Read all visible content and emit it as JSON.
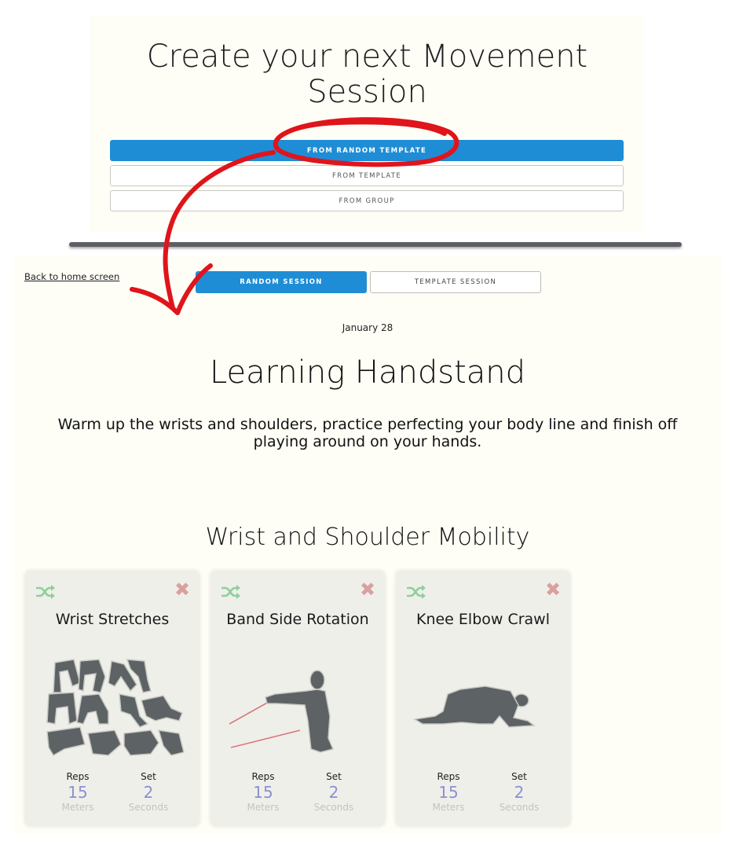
{
  "builder": {
    "title": "Create your next Movement Session",
    "options": [
      {
        "label": "FROM RANDOM TEMPLATE"
      },
      {
        "label": "FROM TEMPLATE"
      },
      {
        "label": "FROM GROUP"
      }
    ]
  },
  "session": {
    "back_link": "Back to home screen",
    "tabs": [
      {
        "label": "RANDOM SESSION",
        "active": true
      },
      {
        "label": "TEMPLATE SESSION",
        "active": false
      }
    ],
    "date": "January 28",
    "title": "Learning Handstand",
    "description": "Warm up the wrists and shoulders, practice perfecting your body line and finish off playing around on your hands.",
    "section": {
      "title": "Wrist and Shoulder Mobility",
      "exercises": [
        {
          "name": "Wrist Stretches",
          "reps_label": "Reps",
          "reps": "15",
          "reps_unit": "Meters",
          "set_label": "Set",
          "set": "2",
          "set_unit": "Seconds",
          "shuffle_icon": "shuffle-icon",
          "remove_icon": "close-icon"
        },
        {
          "name": "Band Side Rotation",
          "reps_label": "Reps",
          "reps": "15",
          "reps_unit": "Meters",
          "set_label": "Set",
          "set": "2",
          "set_unit": "Seconds",
          "shuffle_icon": "shuffle-icon",
          "remove_icon": "close-icon"
        },
        {
          "name": "Knee Elbow Crawl",
          "reps_label": "Reps",
          "reps": "15",
          "reps_unit": "Meters",
          "set_label": "Set",
          "set": "2",
          "set_unit": "Seconds",
          "shuffle_icon": "shuffle-icon",
          "remove_icon": "close-icon"
        }
      ]
    }
  },
  "colors": {
    "accent": "#1f8dd6",
    "panel_bg": "#fefef6",
    "card_bg": "#efefea",
    "shuffle": "#8fcf9a",
    "remove": "#d9a0a0",
    "stat_value": "#8d8fd0",
    "annotation": "#e0141b"
  }
}
